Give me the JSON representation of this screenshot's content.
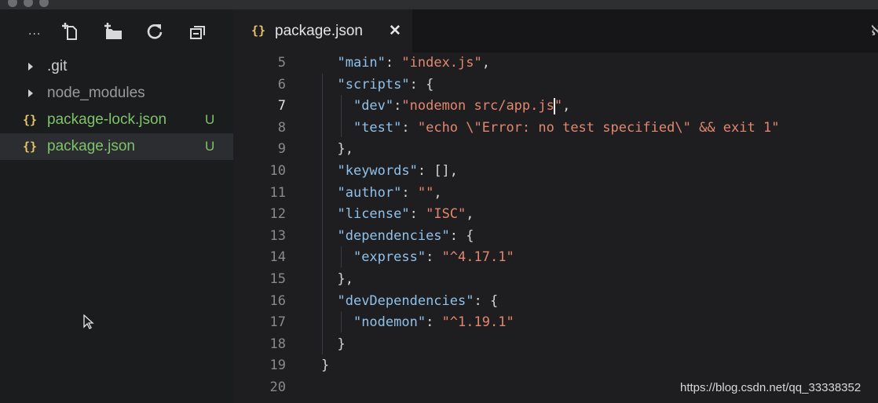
{
  "sidebar": {
    "toolbar": {
      "more_label": "...",
      "icons": [
        "new-file-icon",
        "new-folder-icon",
        "refresh-icon",
        "collapse-all-icon"
      ]
    },
    "items": [
      {
        "label": ".git",
        "kind": "folder",
        "badge": ""
      },
      {
        "label": "node_modules",
        "kind": "folder",
        "badge": ""
      },
      {
        "label": "package-lock.json",
        "kind": "json",
        "badge": "U"
      },
      {
        "label": "package.json",
        "kind": "json",
        "badge": "U",
        "selected": true
      }
    ]
  },
  "editor": {
    "tab": {
      "braces": "{}",
      "label": "package.json",
      "close": "✕"
    },
    "active_line": "7",
    "lines": [
      {
        "n": "5",
        "t": "  \"main\": \"index.js\","
      },
      {
        "n": "6",
        "t": "  \"scripts\": {"
      },
      {
        "n": "7",
        "t": "    \"dev\":\"nodemon src/app.js\","
      },
      {
        "n": "8",
        "t": "    \"test\": \"echo \\\"Error: no test specified\\\" && exit 1\""
      },
      {
        "n": "9",
        "t": "  },"
      },
      {
        "n": "10",
        "t": "  \"keywords\": [],"
      },
      {
        "n": "11",
        "t": "  \"author\": \"\","
      },
      {
        "n": "12",
        "t": "  \"license\": \"ISC\","
      },
      {
        "n": "13",
        "t": "  \"dependencies\": {"
      },
      {
        "n": "14",
        "t": "    \"express\": \"^4.17.1\""
      },
      {
        "n": "15",
        "t": "  },"
      },
      {
        "n": "16",
        "t": "  \"devDependencies\": {"
      },
      {
        "n": "17",
        "t": "    \"nodemon\": \"^1.19.1\""
      },
      {
        "n": "18",
        "t": "  }"
      },
      {
        "n": "19",
        "t": "}"
      },
      {
        "n": "20",
        "t": ""
      }
    ]
  },
  "watermark": "https://blog.csdn.net/qq_33338352",
  "colors": {
    "key": "#8fc1e9",
    "string": "#e2876f",
    "untracked": "#7fc26a",
    "json_icon": "#e5c46a"
  }
}
